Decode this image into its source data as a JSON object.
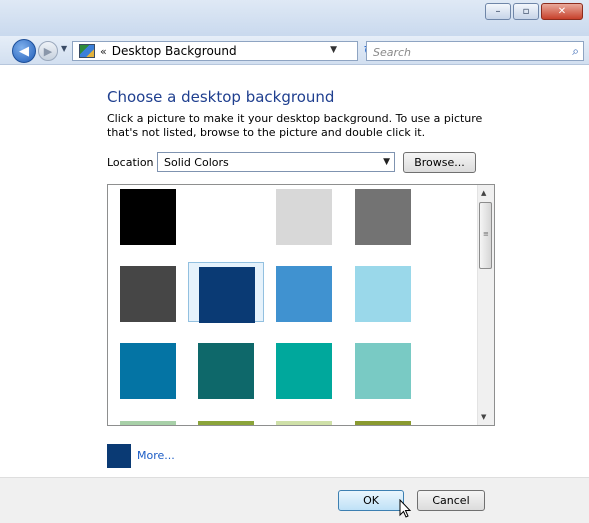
{
  "window": {
    "minimize_icon": "minimize-icon",
    "maximize_icon": "maximize-icon",
    "close_icon": "close-icon",
    "close_glyph": "✕",
    "minimize_glyph": "–",
    "maximize_glyph": "▫"
  },
  "navbar": {
    "back_glyph": "◀",
    "forward_glyph": "▶",
    "history_glyph": "▼",
    "address_chevron": "«",
    "address_text": "Desktop Background",
    "address_drop_glyph": "▼",
    "refresh_glyph": "↻",
    "search_placeholder": "Search",
    "search_glyph": "⌕"
  },
  "content": {
    "heading": "Choose a desktop background",
    "description": "Click a picture to make it your desktop background. To use a picture that's not listed, browse to the picture and double click it.",
    "location_label": "Location",
    "location_value": "Solid Colors",
    "browse_label": "Browse...",
    "more_label": "More...",
    "more_color": "#0a3a74"
  },
  "swatches": [
    {
      "color": "#000000",
      "selected": false
    },
    {
      "color": "#ffffff",
      "selected": false
    },
    {
      "color": "#d8d8d8",
      "selected": false
    },
    {
      "color": "#737373",
      "selected": false
    },
    {
      "color": "#464646",
      "selected": false
    },
    {
      "color": "#0a3a74",
      "selected": true
    },
    {
      "color": "#4092d0",
      "selected": false
    },
    {
      "color": "#9ad8ea",
      "selected": false
    },
    {
      "color": "#0474a4",
      "selected": false
    },
    {
      "color": "#0e686a",
      "selected": false
    },
    {
      "color": "#00a89c",
      "selected": false
    },
    {
      "color": "#79cac4",
      "selected": false
    }
  ],
  "partial_row_colors": [
    "#a8d0a8",
    "#8ba43a",
    "#cfe0a8",
    "#8a9a30"
  ],
  "footer": {
    "ok_label": "OK",
    "cancel_label": "Cancel"
  }
}
